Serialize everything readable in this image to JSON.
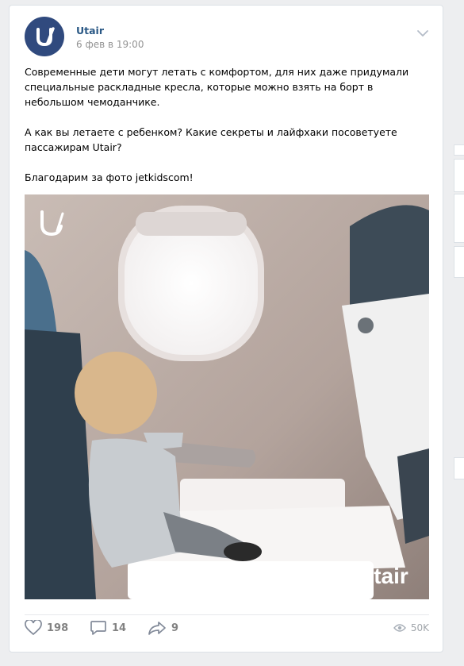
{
  "post": {
    "author": "Utair",
    "date": "6 фев в 19:00",
    "paragraphs": [
      "Современные дети могут летать с комфортом, для них даже придумали специальные раскладные кресла, которые можно взять на борт в небольшом чемоданчике.",
      "А как вы летаете с ребенком? Какие секреты и лайфхаки посоветуете пассажирам Utair?",
      "Благодарим за фото jetkidscom!"
    ],
    "photo_watermark": "Utair",
    "brand_color": "#304a7e"
  },
  "actions": {
    "likes": "198",
    "comments": "14",
    "shares": "9",
    "views": "50K"
  },
  "icons": [
    "utair-logo-icon",
    "chevron-down-icon",
    "heart-icon",
    "comment-icon",
    "share-icon",
    "eye-icon"
  ]
}
